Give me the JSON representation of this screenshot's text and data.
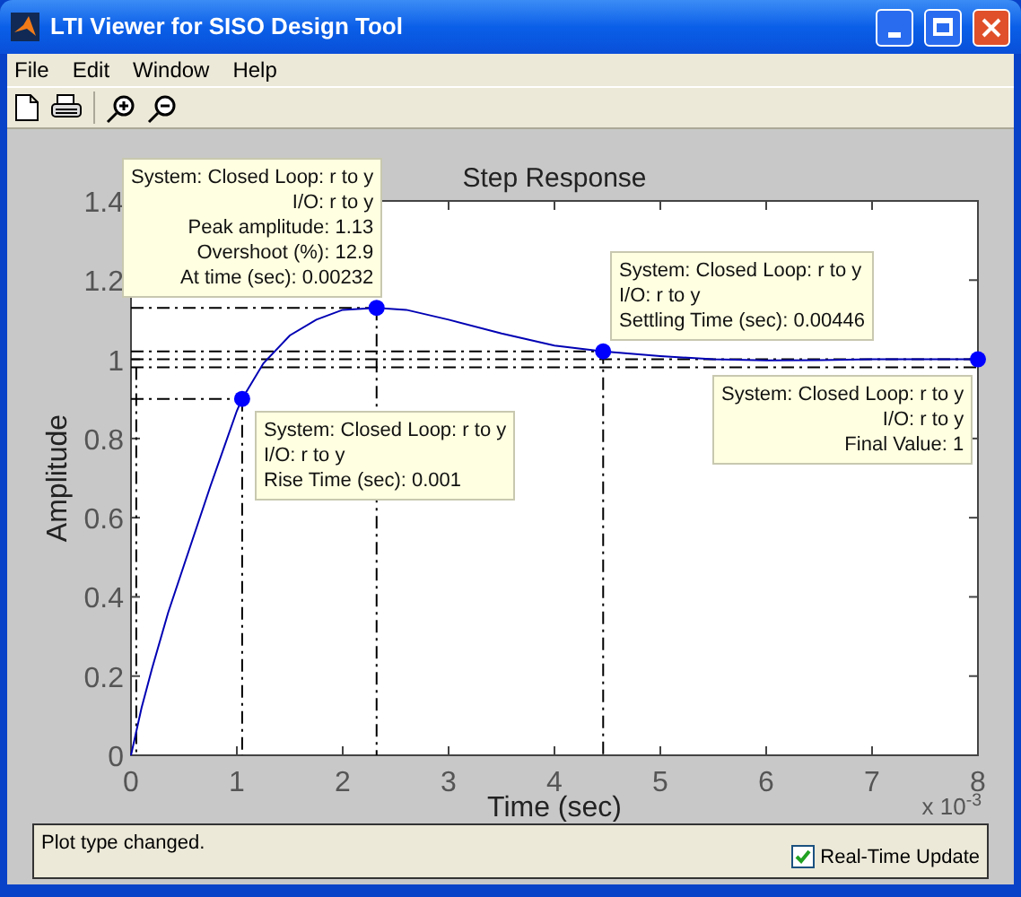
{
  "window": {
    "title": "LTI Viewer for SISO Design Tool"
  },
  "menu": [
    {
      "label": "File"
    },
    {
      "label": "Edit"
    },
    {
      "label": "Window"
    },
    {
      "label": "Help"
    }
  ],
  "plot": {
    "x_scale_label": "x 10$^{-3}$",
    "chart_data": {
      "type": "line",
      "title": "Step Response",
      "xlabel": "Time (sec)",
      "ylabel": "Amplitude",
      "x": [
        0,
        0.1,
        0.2,
        0.35,
        0.5,
        0.75,
        1,
        1.05,
        1.25,
        1.5,
        1.75,
        2,
        2.32,
        2.6,
        3,
        3.5,
        4,
        4.46,
        5,
        5.5,
        6,
        6.5,
        7,
        7.5,
        8
      ],
      "series": [
        {
          "color": "#0000b4",
          "values": [
            0,
            0.12,
            0.22,
            0.36,
            0.48,
            0.68,
            0.87,
            0.9,
            0.99,
            1.06,
            1.1,
            1.125,
            1.13,
            1.125,
            1.1,
            1.065,
            1.035,
            1.02,
            1.008,
            1.0,
            0.997,
            0.998,
            1.0,
            1.0,
            1.0
          ]
        }
      ],
      "xlim": [
        0,
        8
      ],
      "ylim": [
        0,
        1.4
      ],
      "xticks": [
        0,
        1,
        2,
        3,
        4,
        5,
        6,
        7,
        8
      ],
      "yticks": [
        0,
        0.2,
        0.4,
        0.6,
        0.8,
        1,
        1.2,
        1.4
      ],
      "ref_lines": [
        {
          "axis": "y",
          "value": 1.02
        },
        {
          "axis": "y",
          "value": 0.98
        },
        {
          "axis": "y",
          "value": 0.9
        },
        {
          "axis": "x",
          "value": 1.05
        },
        {
          "axis": "x",
          "value": 0.05
        }
      ],
      "annotations": [
        {
          "x": 2.32,
          "y": 1.13,
          "text": "System: Closed Loop: r to y\nI/O: r to y\nPeak amplitude: 1.13\nOvershoot (%): 12.9\nAt time (sec): 0.00232"
        },
        {
          "x": 1.05,
          "y": 0.9,
          "text": "System: Closed Loop: r to y\nI/O: r to y\nRise Time (sec): 0.001"
        },
        {
          "x": 4.46,
          "y": 1.02,
          "text": "System: Closed Loop: r to y\nI/O: r to y\nSettling Time (sec): 0.00446"
        },
        {
          "x": 8,
          "y": 1,
          "text": "System: Closed Loop: r to y\nI/O: r to y\nFinal Value: 1"
        }
      ]
    }
  },
  "status_bar": {
    "message": "Plot type changed.",
    "real_time_update": {
      "label": "Real-Time Update",
      "checked": true
    }
  }
}
